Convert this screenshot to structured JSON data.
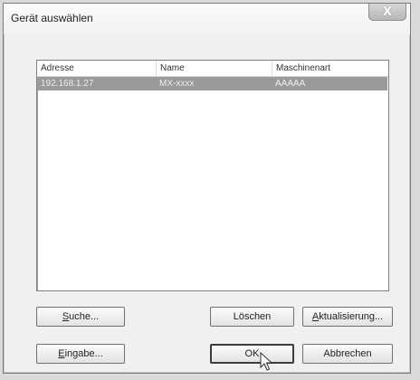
{
  "window": {
    "title": "Gerät auswählen",
    "close_label": "X"
  },
  "list": {
    "columns": [
      "Adresse",
      "Name",
      "Maschinenart"
    ],
    "rows": [
      {
        "address": "192.168.1.27",
        "name": "MX-xxxx",
        "type": "AAAAA"
      }
    ],
    "selected_row_color": "#9a9a9a"
  },
  "buttons": {
    "search": {
      "mnemonic": "S",
      "rest": "uche..."
    },
    "delete": {
      "label": "Löschen"
    },
    "refresh": {
      "pre": "",
      "mnemonic": "A",
      "rest": "ktualisierung..."
    },
    "input": {
      "mnemonic": "E",
      "rest": "ingabe..."
    },
    "ok": {
      "label": "OK"
    },
    "cancel": {
      "label": "Abbrechen"
    }
  }
}
